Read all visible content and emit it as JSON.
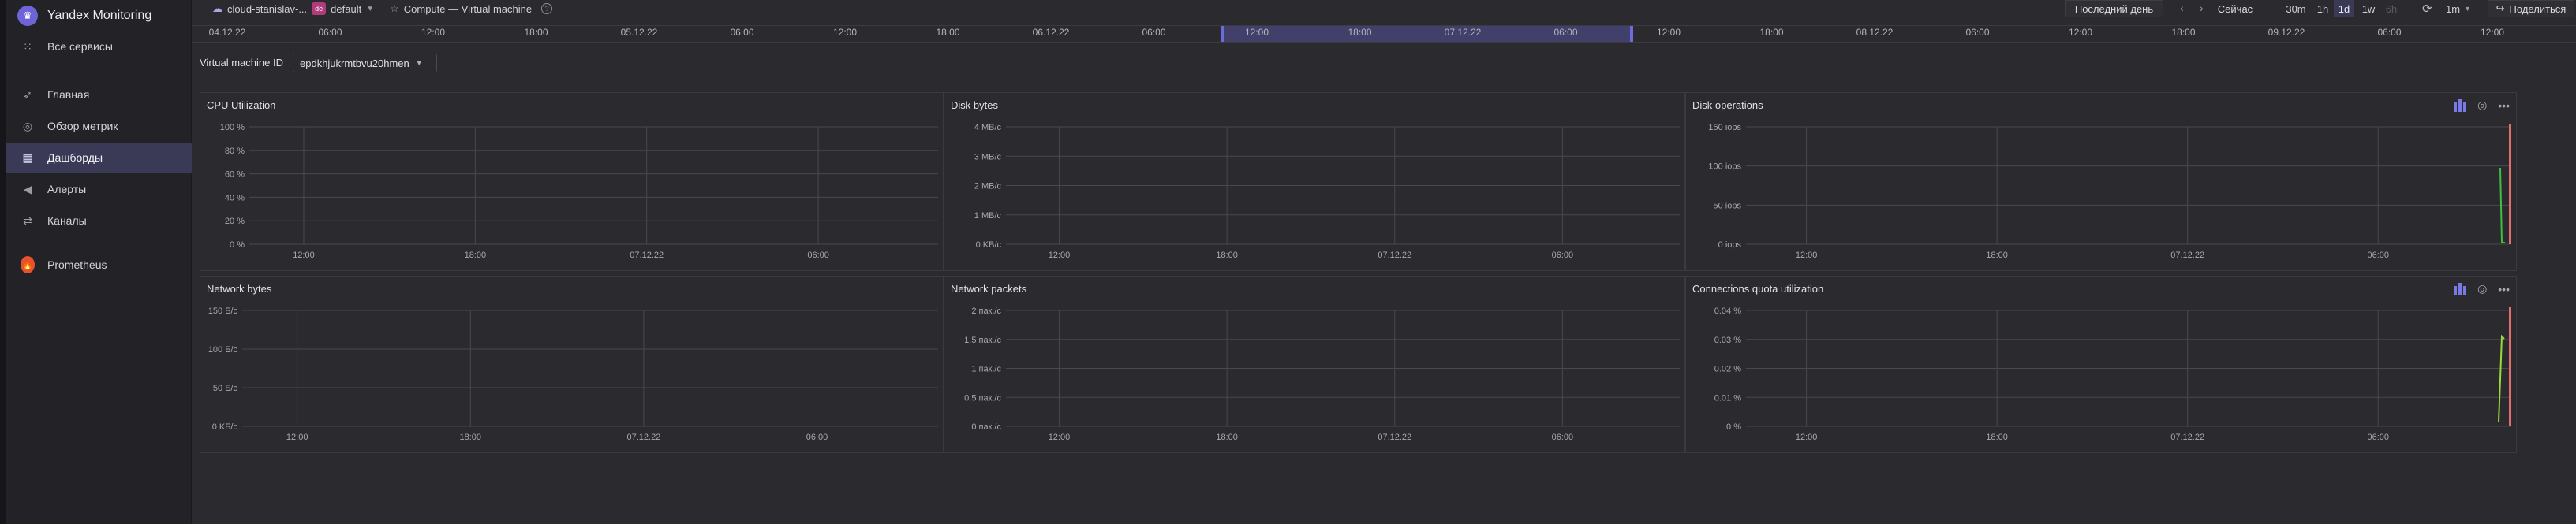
{
  "sidebar": {
    "brand": "Yandex Monitoring",
    "items": [
      {
        "label": "Все сервисы",
        "icon": "grid-icon"
      },
      {
        "label": "Главная",
        "icon": "rocket-icon"
      },
      {
        "label": "Обзор метрик",
        "icon": "compass-icon"
      },
      {
        "label": "Дашборды",
        "icon": "dashboard-icon"
      },
      {
        "label": "Алерты",
        "icon": "megaphone-icon"
      },
      {
        "label": "Каналы",
        "icon": "channels-icon"
      },
      {
        "label": "Prometheus",
        "icon": "prometheus-icon"
      }
    ]
  },
  "topbar": {
    "cloud": "cloud-stanislav-...",
    "folder_badge": "de",
    "folder": "default",
    "dashboard": "Compute — Virtual machine",
    "period_button": "Последний день",
    "now_button": "Сейчас",
    "ranges": [
      "30m",
      "1h",
      "1d",
      "1w",
      "6h"
    ],
    "active_range": "1d",
    "refresh_interval": "1m",
    "share_button": "Поделиться"
  },
  "timeline": {
    "ticks": [
      "04.12.22",
      "06:00",
      "12:00",
      "18:00",
      "05.12.22",
      "06:00",
      "12:00",
      "18:00",
      "06.12.22",
      "06:00",
      "12:00",
      "18:00",
      "07.12.22",
      "06:00",
      "12:00",
      "18:00",
      "08.12.22",
      "06:00",
      "12:00",
      "18:00",
      "09.12.22",
      "06:00",
      "12:00"
    ]
  },
  "variable": {
    "label": "Virtual machine ID",
    "value": "epdkhjukrmtbvu20hmen"
  },
  "panels": [
    {
      "title": "CPU Utilization",
      "y_ticks": [
        "100 %",
        "80 %",
        "60 %",
        "40 %",
        "20 %",
        "0 %"
      ],
      "x_ticks": [
        "12:00",
        "18:00",
        "07.12.22",
        "06:00"
      ],
      "tools": false
    },
    {
      "title": "Disk bytes",
      "y_ticks": [
        "4 MB/c",
        "3 MB/c",
        "2 MB/c",
        "1 MB/c",
        "0 KB/c"
      ],
      "x_ticks": [
        "12:00",
        "18:00",
        "07.12.22",
        "06:00"
      ],
      "tools": false
    },
    {
      "title": "Disk operations",
      "y_ticks": [
        "150 iops",
        "100 iops",
        "50 iops",
        "0 iops"
      ],
      "x_ticks": [
        "12:00",
        "18:00",
        "07.12.22",
        "06:00"
      ],
      "tools": true
    },
    {
      "title": "Network bytes",
      "y_ticks": [
        "150 Б/c",
        "100 Б/c",
        "50 Б/c",
        "0 KБ/c"
      ],
      "x_ticks": [
        "12:00",
        "18:00",
        "07.12.22",
        "06:00"
      ],
      "tools": false
    },
    {
      "title": "Network packets",
      "y_ticks": [
        "2 пак./c",
        "1.5 пак./c",
        "1 пак./c",
        "0.5 пак./c",
        "0 пак./c"
      ],
      "x_ticks": [
        "12:00",
        "18:00",
        "07.12.22",
        "06:00"
      ],
      "tools": false
    },
    {
      "title": "Connections quota utilization",
      "y_ticks": [
        "0.04 %",
        "0.03 %",
        "0.02 %",
        "0.01 %",
        "0 %"
      ],
      "x_ticks": [
        "12:00",
        "18:00",
        "07.12.22",
        "06:00"
      ],
      "tools": true
    }
  ],
  "colors": {
    "accent": "#6f63d8",
    "active_bg": "#3a3a57",
    "series_green": "#3fbf3f",
    "series_lime": "#9ad83a",
    "now_marker": "#e36d6d"
  }
}
